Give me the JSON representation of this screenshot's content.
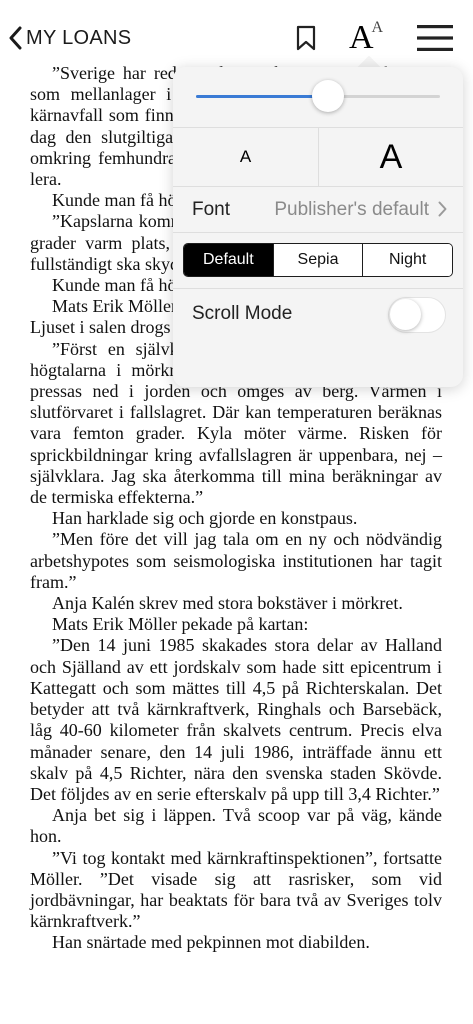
{
  "header": {
    "back_label": "MY LOANS",
    "icons": [
      "chevron-left-icon",
      "bookmark-icon",
      "font-size-icon",
      "hamburger-menu-icon"
    ],
    "font_icon_big": "A",
    "font_icon_small": "A"
  },
  "settings": {
    "brightness_level": 0.54,
    "accent_color": "#3a7bd5",
    "font_size_small": "A",
    "font_size_large": "A",
    "font_label": "Font",
    "font_value": "Publisher's default",
    "themes": [
      "Default",
      "Sepia",
      "Night"
    ],
    "active_theme": "Default",
    "scroll_mode_label": "Scroll Mode",
    "scroll_mode_on": false
  },
  "book": {
    "paragraphs": [
      "”Sverige har redan i dag ett bergrum som fungerar som mellanlager i Oskarshamn. Där ska allt svensk kärnavfall som finns där för att svalna förvaras tills den dag den slutgiltiga domen ska slutförvaras i berg på omkring femhundra meters djup, ingjutna i betong och lera.",
      "Kunde man få höra något mer om själva förvaringen?",
      "”Kapslarna kommer att placeras på en omkring tjugu grader varm plats, omgivna av lera som är den som fullständigt ska skydda avfallet.",
      "Kunde man få höra något mer om riskerna?",
      "Mats Erik Möller fortsatte med sin dragning.",
      "Ljuset i salen drogs ned ytterligare.",
      "”Först en självklar sak”, sade han och rösten ur högtalarna i mörkret fick alla att lyssna. ”Kapslarna pressas ned i jorden och omges av berg. Värmen i slutförvaret i fallslagret. Där kan temperaturen beräknas vara femton grader. Kyla möter värme. Risken för sprickbildningar kring avfallslagren är uppenbara, nej – självklara. Jag ska återkomma till mina beräkningar av de termiska effekterna.”",
      "Han harklade sig och gjorde en konstpaus.",
      "”Men före det vill jag tala om en ny och nödvändig arbetshypotes som seismologiska institutionen har tagit fram.”",
      "Anja Kalén skrev med stora bokstäver i mörkret.",
      "Mats Erik Möller pekade på kartan:",
      "”Den 14 juni 1985 skakades stora delar av Halland och Själland av ett jordskalv som hade sitt epicentrum i Kattegatt och som mättes till 4,5 på Richterskalan. Det betyder att två kärnkraftverk, Ringhals och Barsebäck, låg 40-60 kilometer från skalvets centrum. Precis elva månader senare, den 14 juli 1986, inträffade ännu ett skalv på 4,5 Richter, nära den svenska staden Skövde. Det följdes av en serie efterskalv på upp till 3,4 Richter.”",
      "Anja bet sig i läppen. Två scoop var på väg, kände hon.",
      "”Vi tog kontakt med kärnkraftinspektionen”, fortsatte Möller. ”Det visade sig att rasrisker, som vid jordbävningar, har beaktats för bara två av Sveriges tolv kärnkraftverk.”",
      "Han snärtade med pekpinnen mot diabilden."
    ]
  }
}
